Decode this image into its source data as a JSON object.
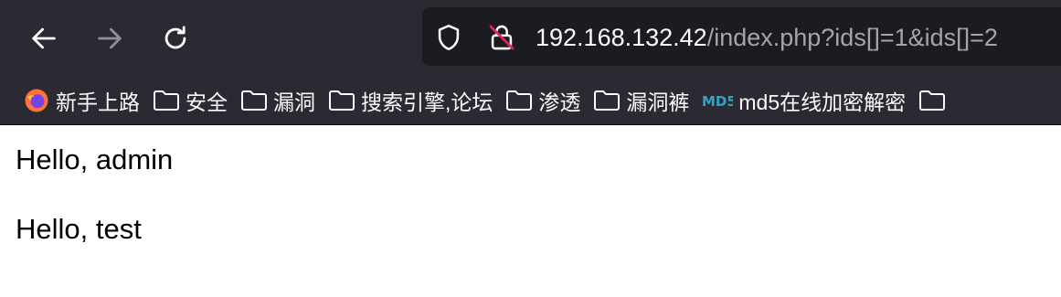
{
  "toolbar": {
    "url_host": "192.168.132.42",
    "url_path": "/index.php?ids[]=1&ids[]=2"
  },
  "bookmarks": [
    {
      "label": "新手上路",
      "icon": "firefox-icon"
    },
    {
      "label": "安全",
      "icon": "folder-icon"
    },
    {
      "label": "漏洞",
      "icon": "folder-icon"
    },
    {
      "label": "搜索引擎,论坛",
      "icon": "folder-icon"
    },
    {
      "label": "渗透",
      "icon": "folder-icon"
    },
    {
      "label": "漏洞裤",
      "icon": "folder-icon"
    },
    {
      "label": "md5在线加密解密",
      "icon": "md5-logo-icon",
      "icon_text": "MD5"
    }
  ],
  "content": {
    "lines": [
      "Hello, admin",
      "Hello, test"
    ]
  },
  "colors": {
    "toolbar_bg": "#2b2a33",
    "urlbar_bg": "#1c1b22",
    "text_light": "#fbfbfe",
    "text_muted": "#a5a4ab",
    "disabled_icon": "#8f8f9d",
    "insecure_red": "#e22850"
  }
}
